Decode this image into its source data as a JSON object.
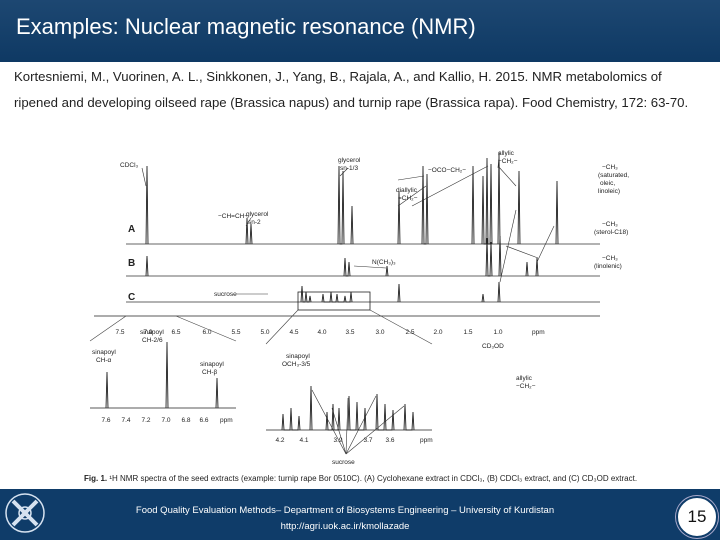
{
  "slide": {
    "title": "Examples: Nuclear magnetic resonance (NMR)",
    "citation": "Kortesniemi, M., Vuorinen, A. L., Sinkkonen, J., Yang, B., Rajala, A., and Kallio, H. 2015. NMR metabolomics of ripened and developing oilseed rape (Brassica napus) and turnip rape (Brassica rapa). Food Chemistry, 172: 63-70.",
    "page_number": "15"
  },
  "figure": {
    "trace_labels": [
      "A",
      "B",
      "C"
    ],
    "peak_labels": {
      "cdcl3": "CDCl₃",
      "glycerol_13": "glycerol",
      "glycerol_13_sub": "sn-1/3",
      "allylic_top": "allylic",
      "allylic_top_sub": "−CH₂−",
      "oco": "−OCO−CH₂−",
      "diallylic": "diallylic",
      "diallylic_sub": "=CH₂−",
      "ch_ch": "−CH=CH−",
      "glycerol_2": "glycerol",
      "glycerol_2_sub": "sn-2",
      "ch3_sat": "−CH₃",
      "ch3_sat_sub1": "(saturated,",
      "ch3_sat_sub2": "oleic,",
      "ch3_sat_sub3": "linoleic)",
      "ch3_sterol": "−CH₃",
      "ch3_sterol_sub": "(sterol-C18)",
      "nch": "N(CH₃)₃",
      "ch3_lin": "−CH₃",
      "ch3_lin_sub": "(linolenic)",
      "sucrose": "sucrose",
      "cd3od": "CD₃OD",
      "allylic_bottom": "allylic",
      "allylic_bottom_sub": "−CH₂−",
      "ppm": "ppm"
    },
    "axis_ticks": [
      "7.5",
      "7.0",
      "6.5",
      "6.0",
      "5.5",
      "5.0",
      "4.5",
      "4.0",
      "3.5",
      "3.0",
      "2.5",
      "2.0",
      "1.5",
      "1.0"
    ],
    "inset1": {
      "labels": [
        "sinapoyl",
        "CH-α",
        "sinapoyl",
        "CH-2/6",
        "sinapoyl",
        "CH-β"
      ],
      "ticks": [
        "7.6",
        "7.4",
        "7.2",
        "7.0",
        "6.8",
        "6.6"
      ],
      "unit": "ppm"
    },
    "inset2": {
      "labels": [
        "sinapoyl",
        "OCH₃-3/5"
      ],
      "ticks": [
        "4.2",
        "4.1",
        "3.9",
        "3.7",
        "3.6"
      ],
      "unit": "ppm",
      "bottom_label": "sucrose"
    },
    "caption_prefix": "Fig. 1.",
    "caption": "¹H NMR spectra of the seed extracts (example: turnip rape Bor 0510C). (A) Cyclohexane extract in CDCl₃, (B) CDCl₃ extract, and (C) CD₃OD extract."
  },
  "footer": {
    "line1": "Food Quality Evaluation Methods– Department of Biosystems Engineering – University of Kurdistan",
    "line2": "http://agri.uok.ac.ir/kmollazade"
  }
}
